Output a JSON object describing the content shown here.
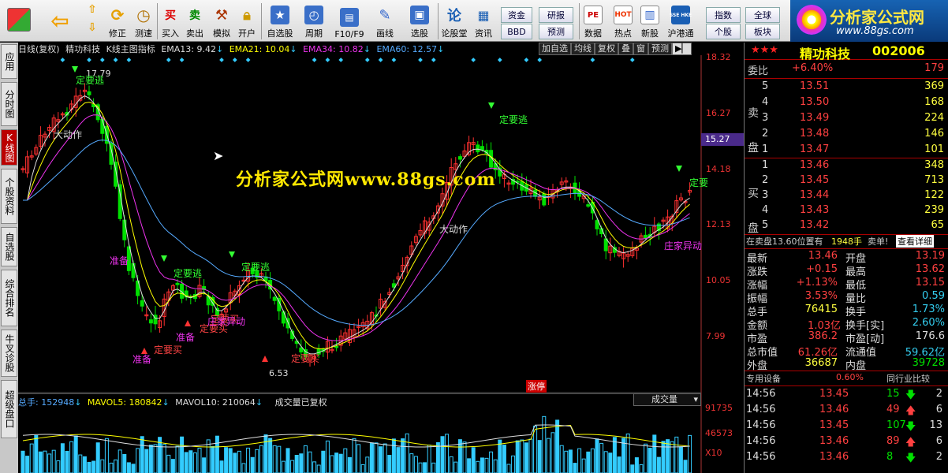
{
  "toolbar": {
    "buttons": [
      {
        "id": "back",
        "label": "",
        "icon": "back-arrow-icon"
      },
      {
        "id": "up",
        "label": "",
        "icon": "up-arrow-icon"
      },
      {
        "id": "revise",
        "label": "修正",
        "icon": "revise-icon"
      },
      {
        "id": "speedtest",
        "label": "测速",
        "icon": "clock-icon"
      },
      {
        "id": "buy",
        "label": "买入",
        "icon": "buy-icon",
        "glyph": "买"
      },
      {
        "id": "sell",
        "label": "卖出",
        "icon": "sell-icon",
        "glyph": "卖"
      },
      {
        "id": "simulate",
        "label": "模拟",
        "icon": "hammer-icon"
      },
      {
        "id": "open",
        "label": "开户",
        "icon": "lock-icon"
      },
      {
        "id": "selfselect",
        "label": "自选股",
        "icon": "star-icon"
      },
      {
        "id": "period",
        "label": "周期",
        "icon": "clock-period-icon"
      },
      {
        "id": "f10",
        "label": "F10/F9",
        "icon": "f10-icon"
      },
      {
        "id": "drawline",
        "label": "画线",
        "icon": "pen-icon"
      },
      {
        "id": "pick",
        "label": "选股",
        "icon": "screen-icon"
      },
      {
        "id": "forum",
        "label": "论股堂",
        "icon": "forum-icon",
        "glyph": "论"
      },
      {
        "id": "news",
        "label": "资讯",
        "icon": "news-icon"
      },
      {
        "id": "data",
        "label": "数据",
        "icon": "pe-icon",
        "glyph": "PE"
      },
      {
        "id": "hot",
        "label": "热点",
        "icon": "hot-icon",
        "glyph": "HOT"
      },
      {
        "id": "newstock",
        "label": "新股",
        "icon": "newstock-icon"
      },
      {
        "id": "hkconnect",
        "label": "沪港通",
        "icon": "hk-icon",
        "glyph": "SSE HKE"
      }
    ],
    "small": [
      "资金",
      "研报",
      "BBD",
      "预测",
      "指数",
      "全球",
      "个股",
      "板块"
    ]
  },
  "logo": {
    "title": "分析家公式网",
    "url": "www.88gs.com"
  },
  "left_tabs": [
    "应用",
    "分时图",
    "K线图",
    "个股资料",
    "自选股",
    "综合排名",
    "牛叉诊股",
    "超级盘口"
  ],
  "chart": {
    "info": {
      "title": "日线(复权)",
      "stock": "精功科技",
      "indicator": "K线主图指标",
      "ema13": "EMA13: 9.42",
      "ema21": "EMA21: 10.04",
      "ema34": "EMA34: 10.82",
      "ema60": "EMA60: 12.57"
    },
    "buttons": [
      "加自选",
      "均线",
      "复权",
      "叠",
      "窗",
      "预测"
    ],
    "price_axis": [
      "18.32",
      "16.27",
      "15.27",
      "14.18",
      "12.13",
      "10.05",
      "7.99"
    ],
    "annotations": {
      "high": "17.79",
      "low": "6.53",
      "flee": "定要逃",
      "buy": "定要买",
      "ready": "准备",
      "big_move": "大动作",
      "dealer": "庄家异动",
      "limit": "涨停",
      "flee_short": "定要"
    },
    "watermark": "分析家公式网www.88gs.com",
    "volume": {
      "total": "总手: 152948",
      "mavol5": "MAVOL5: 180842",
      "mavol10": "MAVOL10: 210064",
      "note": "成交量已复权",
      "selector": "成交量",
      "axis": [
        "91735",
        "46573",
        "X10"
      ]
    }
  },
  "quote": {
    "title": "精功科技",
    "code": "002006",
    "weibi_label": "委比",
    "weibi": "+6.40%",
    "weicha": "179",
    "sell_label": "卖盘",
    "buy_label": "买盘",
    "asks": [
      {
        "lvl": "5",
        "price": "13.51",
        "vol": "369"
      },
      {
        "lvl": "4",
        "price": "13.50",
        "vol": "168"
      },
      {
        "lvl": "3",
        "price": "13.49",
        "vol": "224"
      },
      {
        "lvl": "2",
        "price": "13.48",
        "vol": "146"
      },
      {
        "lvl": "1",
        "price": "13.47",
        "vol": "101"
      }
    ],
    "bids": [
      {
        "lvl": "1",
        "price": "13.46",
        "vol": "348"
      },
      {
        "lvl": "2",
        "price": "13.45",
        "vol": "713"
      },
      {
        "lvl": "3",
        "price": "13.44",
        "vol": "122"
      },
      {
        "lvl": "4",
        "price": "13.43",
        "vol": "239"
      },
      {
        "lvl": "5",
        "price": "13.42",
        "vol": "65"
      }
    ],
    "order_info": "在卖盘13.60位置有",
    "order_vol": "1948手",
    "order_note": "卖单!",
    "order_link": "查看详细",
    "stats": [
      [
        "最新",
        "13.46",
        "开盘",
        "13.19"
      ],
      [
        "涨跌",
        "+0.15",
        "最高",
        "13.62"
      ],
      [
        "涨幅",
        "+1.13%",
        "最低",
        "13.15"
      ],
      [
        "振幅",
        "3.53%",
        "量比",
        "0.59"
      ],
      [
        "总手",
        "76415",
        "换手",
        "1.73%"
      ],
      [
        "金额",
        "1.03亿",
        "换手[实]",
        "2.60%"
      ],
      [
        "市盈",
        "386.2",
        "市盈[动]",
        "176.6"
      ],
      [
        "总市值",
        "61.26亿",
        "流通值",
        "59.62亿"
      ],
      [
        "外盘",
        "36687",
        "内盘",
        "39728"
      ]
    ],
    "device_label": "专用设备",
    "device_pct": "0.60%",
    "compare_label": "同行业比较",
    "ticks": [
      {
        "time": "14:56",
        "price": "13.45",
        "vol": "15",
        "dir": "down",
        "n": "2"
      },
      {
        "time": "14:56",
        "price": "13.46",
        "vol": "49",
        "dir": "up",
        "n": "6"
      },
      {
        "time": "14:56",
        "price": "13.45",
        "vol": "107",
        "dir": "down",
        "n": "13"
      },
      {
        "time": "14:56",
        "price": "13.46",
        "vol": "89",
        "dir": "up",
        "n": "6"
      },
      {
        "time": "14:56",
        "price": "13.46",
        "vol": "8",
        "dir": "down",
        "n": "2"
      }
    ]
  }
}
